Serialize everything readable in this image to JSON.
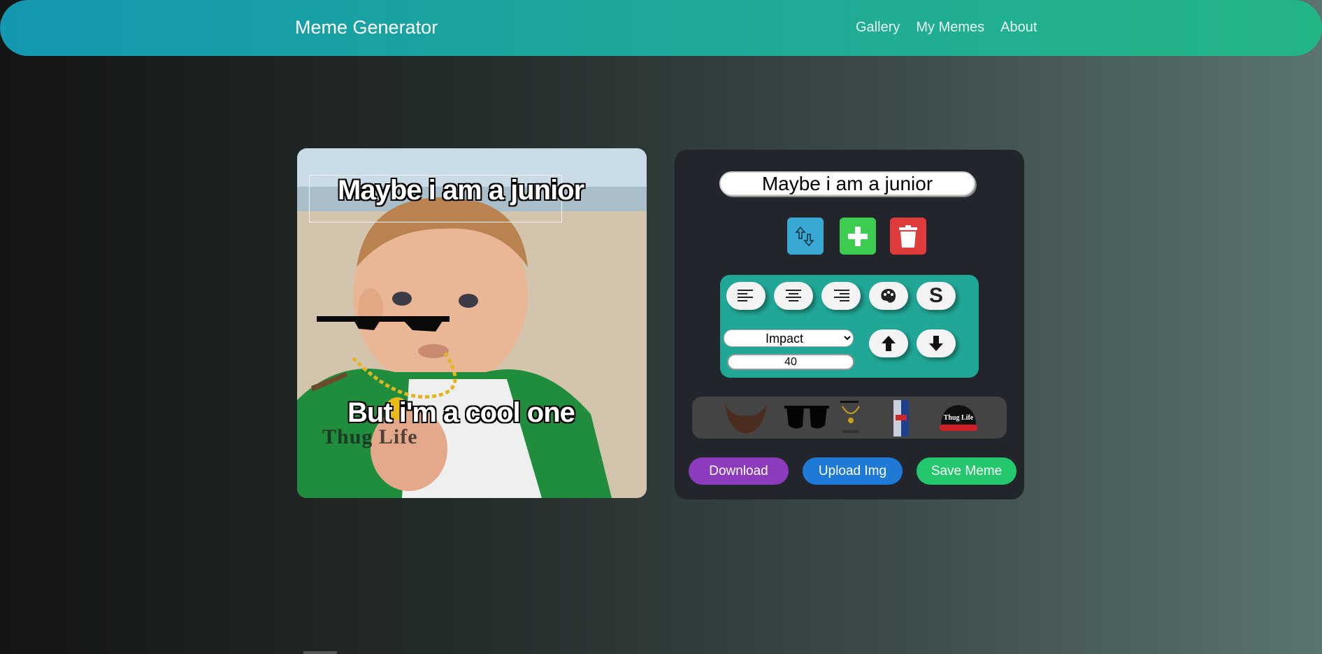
{
  "header": {
    "brand": "Meme Generator",
    "nav": [
      "Gallery",
      "My Memes",
      "About"
    ]
  },
  "meme": {
    "top_text": "Maybe i am a junior",
    "bottom_text": "But i'm a cool one",
    "sticker_caption": "Thug Life"
  },
  "editor": {
    "text_value": "Maybe i am a junior",
    "font": "Impact",
    "font_options": [
      "Impact"
    ],
    "size": "40",
    "stickers": [
      "beard",
      "sunglasses",
      "thug-life-chain",
      "red-bull-can",
      "thug-life-cap"
    ],
    "cap_text": "Thug Life"
  },
  "actions": {
    "download": "Download",
    "upload": "Upload Img",
    "save": "Save Meme"
  },
  "colors": {
    "header_start": "#1398b0",
    "header_end": "#22b586",
    "panel": "#22252c",
    "tools": "#21a796",
    "download": "#8c3bbf",
    "upload": "#1f7ad6",
    "save": "#22c86b"
  }
}
